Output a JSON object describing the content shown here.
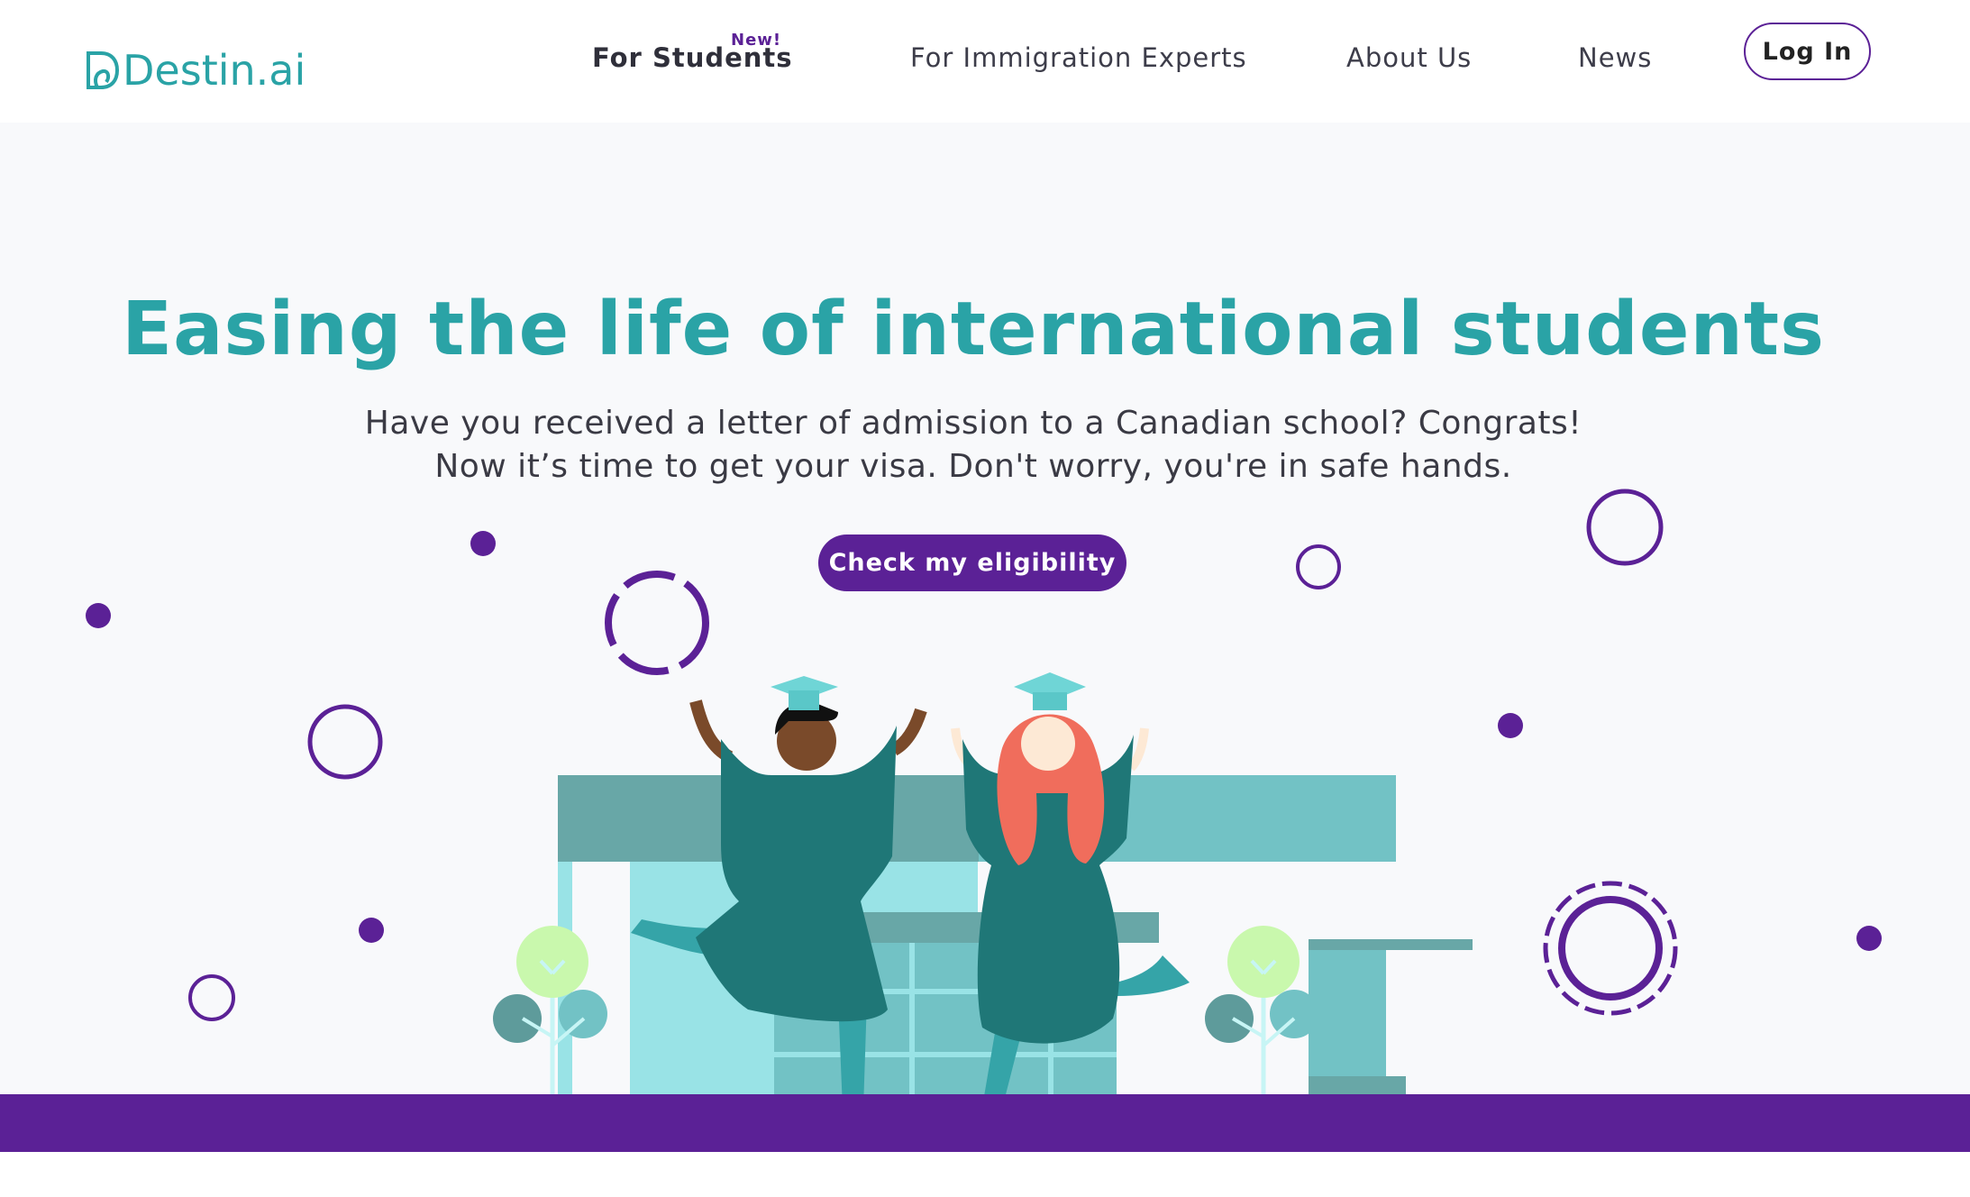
{
  "brand": {
    "name": "Destin.ai",
    "primary_color": "#2aa3a6",
    "accent_color": "#5b2196"
  },
  "nav": {
    "items": [
      {
        "label": "For Students",
        "badge": "New!"
      },
      {
        "label": "For Immigration Experts"
      },
      {
        "label": "About Us"
      },
      {
        "label": "News"
      }
    ],
    "login_label": "Log In"
  },
  "hero": {
    "headline": "Easing the life of international students",
    "subtext_line1": "Have you received a letter of admission to a Canadian school? Congrats!",
    "subtext_line2": "Now it’s time to get your visa. Don't worry, you're in safe hands.",
    "cta_label": "Check my eligibility"
  },
  "illustration": {
    "icons": [
      "graduate-man",
      "graduate-woman",
      "school-building",
      "tree",
      "tree",
      "circle-decoration"
    ]
  }
}
